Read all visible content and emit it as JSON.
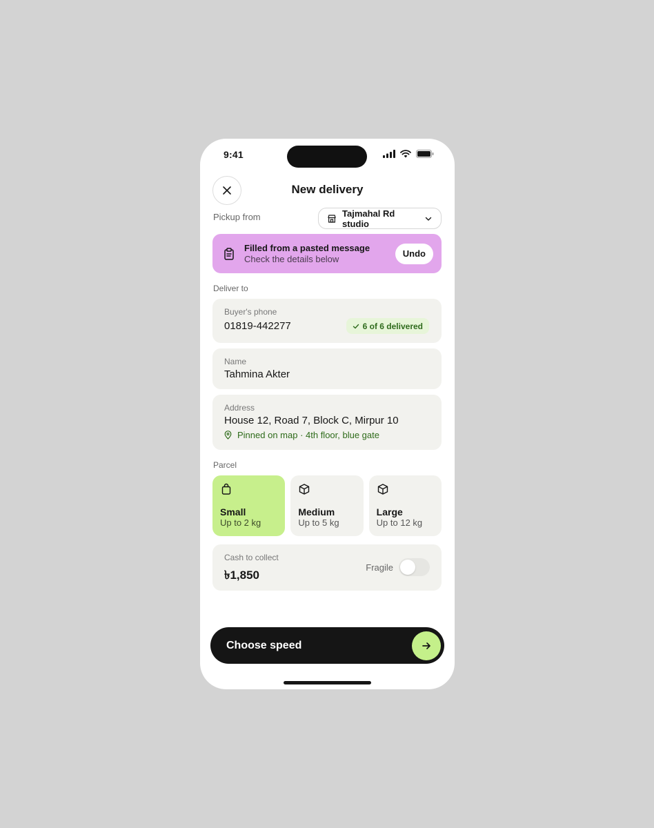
{
  "status": {
    "time": "9:41"
  },
  "nav": {
    "title": "New delivery",
    "close_icon": "close-icon"
  },
  "pickup": {
    "label": "Pickup from",
    "value": "Tajmahal Rd studio"
  },
  "banner": {
    "title": "Filled from a pasted message",
    "subtitle": "Check the details below",
    "undo": "Undo",
    "color": "#e2a6ec"
  },
  "deliver": {
    "label": "Deliver to",
    "phone": {
      "label": "Buyer's phone",
      "value": "01819-442277",
      "badge": "6 of 6 delivered"
    },
    "name": {
      "label": "Name",
      "value": "Tahmina Akter"
    },
    "address": {
      "label": "Address",
      "value": "House 12, Road 7, Block C, Mirpur 10",
      "pin_note": "Pinned on map · 4th floor, blue gate"
    }
  },
  "parcel": {
    "label": "Parcel",
    "options": [
      {
        "name": "Small",
        "sub": "Up to 2 kg",
        "icon": "bag-icon",
        "selected": true
      },
      {
        "name": "Medium",
        "sub": "Up to 5 kg",
        "icon": "box-icon",
        "selected": false
      },
      {
        "name": "Large",
        "sub": "Up to 12 kg",
        "icon": "box-icon",
        "selected": false
      }
    ],
    "selected_color": "#c7ef8c"
  },
  "cash": {
    "label": "Cash to collect",
    "value": "৳1,850",
    "fragile_label": "Fragile",
    "fragile_on": false
  },
  "cta": {
    "label": "Choose speed",
    "accent": "#c4f08a"
  }
}
